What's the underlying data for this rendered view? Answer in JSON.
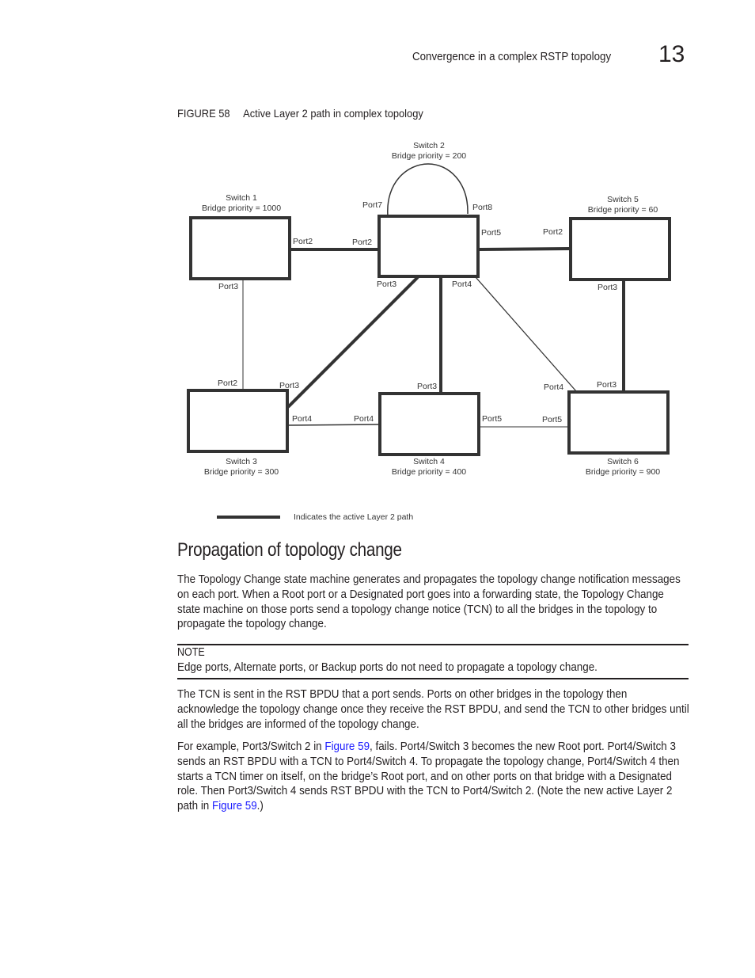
{
  "header": {
    "running_title": "Convergence in a complex RSTP topology",
    "chapter_number": "13"
  },
  "figure": {
    "number": "FIGURE 58",
    "title": "Active Layer 2 path in complex topology",
    "switches": [
      {
        "id": "switch1",
        "name": "Switch 1",
        "priority": "Bridge priority = 1000"
      },
      {
        "id": "switch2",
        "name": "Switch 2",
        "priority": "Bridge priority = 200"
      },
      {
        "id": "switch3",
        "name": "Switch 3",
        "priority": "Bridge priority = 300"
      },
      {
        "id": "switch4",
        "name": "Switch 4",
        "priority": "Bridge priority = 400"
      },
      {
        "id": "switch5",
        "name": "Switch 5",
        "priority": "Bridge priority = 60"
      },
      {
        "id": "switch6",
        "name": "Switch 6",
        "priority": "Bridge priority = 900"
      }
    ],
    "links": [
      {
        "from": "Switch 1 Port2",
        "to": "Switch 2 Port2",
        "active": true
      },
      {
        "from": "Switch 1 Port3",
        "to": "Switch 3 Port2",
        "active": false
      },
      {
        "from": "Switch 2 Port3",
        "to": "Switch 3 Port3",
        "active": true
      },
      {
        "from": "Switch 2 Port4",
        "to": "Switch 4 Port3",
        "active": true
      },
      {
        "from": "Switch 2 Port4",
        "to": "Switch 6 Port4",
        "active": false
      },
      {
        "from": "Switch 2 Port5",
        "to": "Switch 5 Port2",
        "active": true
      },
      {
        "from": "Switch 2 Port7",
        "to": "Switch 2 Port8",
        "active": false
      },
      {
        "from": "Switch 3 Port4",
        "to": "Switch 4 Port4",
        "active": false
      },
      {
        "from": "Switch 4 Port5",
        "to": "Switch 6 Port5",
        "active": false
      },
      {
        "from": "Switch 5 Port3",
        "to": "Switch 6 Port3",
        "active": true
      }
    ],
    "port_labels": {
      "s1_port2": "Port2",
      "s1_port3": "Port3",
      "s2_port7": "Port7",
      "s2_port8": "Port8",
      "s2_port2": "Port2",
      "s2_port5": "Port5",
      "s2_port3": "Port3",
      "s2_port4": "Port4",
      "s5_port2": "Port2",
      "s5_port3": "Port3",
      "s3_port2": "Port2",
      "s3_port3": "Port3",
      "s3_port4": "Port4",
      "s4_port3": "Port3",
      "s4_port4": "Port4",
      "s4_port5": "Port5",
      "s6_port4": "Port4",
      "s6_port3": "Port3",
      "s6_port5": "Port5"
    },
    "legend": "Indicates the active Layer 2 path"
  },
  "section": {
    "heading": "Propagation of topology change",
    "para1": "The Topology Change state machine generates and propagates the topology change notification messages on each port. When a Root port or a Designated port goes into a forwarding state, the Topology Change state machine on those ports send a topology change notice (TCN) to all the bridges in the topology to propagate the topology change.",
    "note_label": "NOTE",
    "note_text": "Edge ports, Alternate ports, or Backup ports do not need to propagate a topology change.",
    "para2": "The TCN is sent in the RST BPDU that a port sends. Ports on other bridges in the topology then acknowledge the topology change once they receive the RST BPDU, and send the TCN to other bridges until all the bridges are informed of the topology change.",
    "para3_a": "For example, Port3/Switch 2 in ",
    "para3_link1": "Figure 59",
    "para3_b": ", fails. Port4/Switch 3 becomes the new Root port. Port4/Switch 3 sends an RST BPDU with a TCN to Port4/Switch 4. To propagate the topology change, Port4/Switch 4 then starts a TCN timer on itself, on the bridge’s Root port, and on other ports on that bridge with a Designated role. Then Port3/Switch 4 sends RST BPDU with the TCN to Port4/Switch 2. (Note the new active Layer 2 path in ",
    "para3_link2": "Figure 59",
    "para3_c": ".)",
    "link_color": "#1a1aff"
  }
}
